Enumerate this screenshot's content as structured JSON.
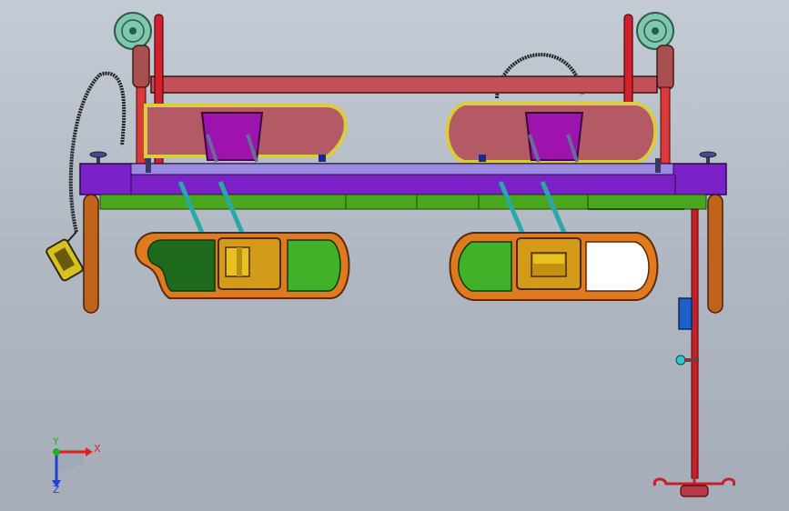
{
  "viewport": {
    "background_top": "#c4cbd4",
    "background_bottom": "#a6adb9"
  },
  "triad": {
    "x_label": "X",
    "y_label": "Y",
    "z_label": "Z",
    "x_color": "#e02020",
    "y_color": "#20b020",
    "z_color": "#2040d0"
  },
  "colors": {
    "frame_purple": "#7a22c8",
    "rail_red": "#d61f2c",
    "headboard_rose": "#b8545c",
    "wood_leg": "#c0641c",
    "deck_green": "#4aa61c",
    "side_rail_orange": "#e07a1e",
    "side_rail_inner_green": "#3fb22a",
    "caster_teal": "#6fb7a0",
    "mechanism_magenta": "#a010b0",
    "iv_pole_red": "#c81e28",
    "accessory_blue": "#1f5fc8"
  }
}
